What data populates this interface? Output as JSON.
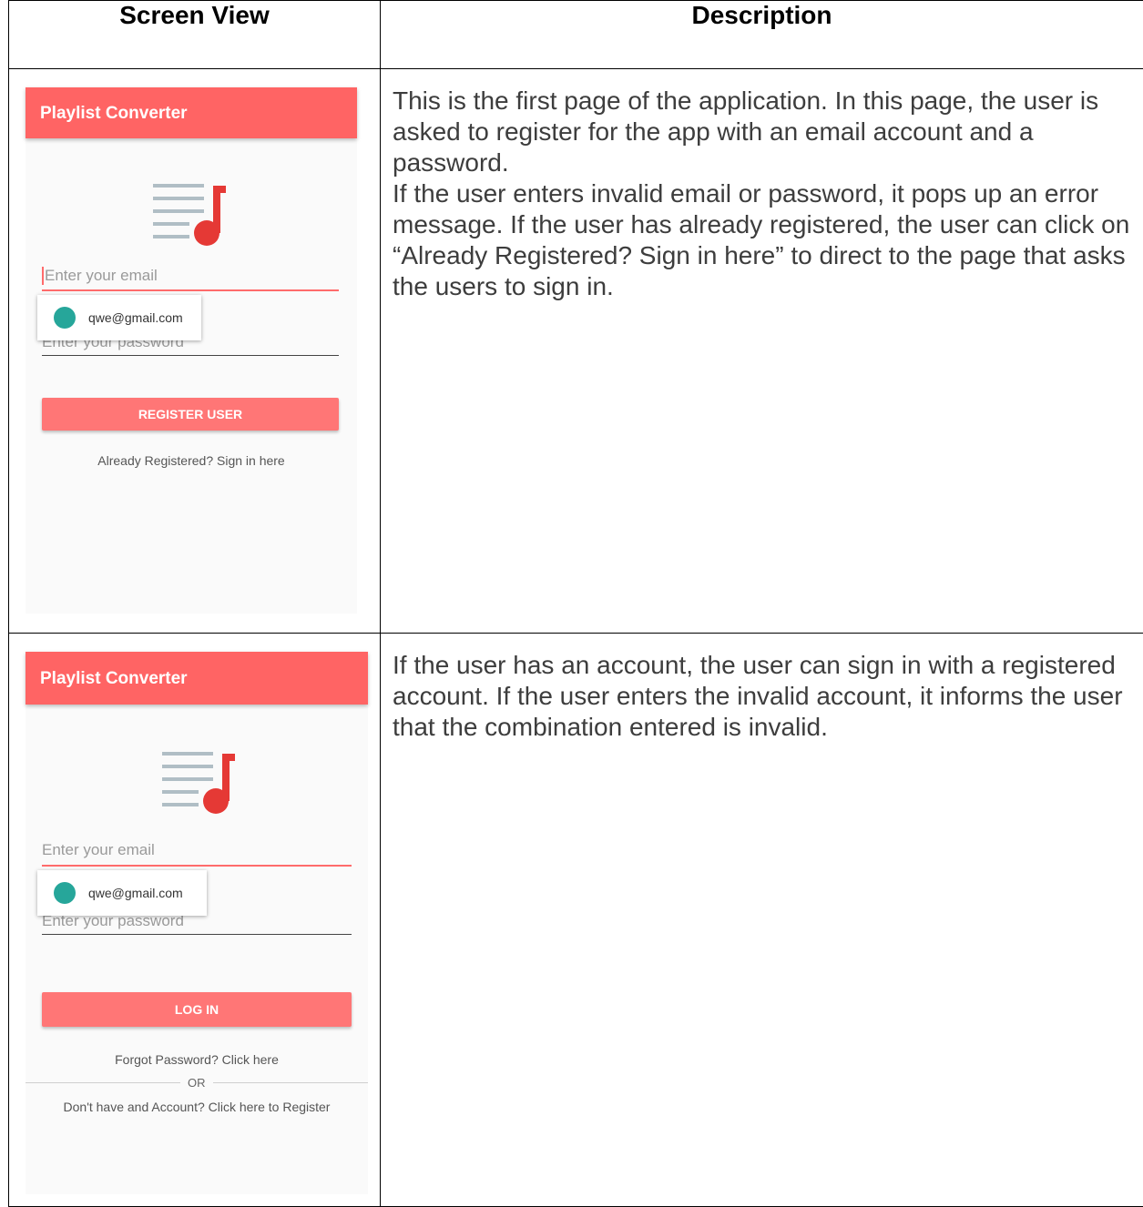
{
  "table": {
    "header_screen": "Screen View",
    "header_description": "Description"
  },
  "rows": [
    {
      "screen": {
        "app_title": "Playlist Converter",
        "email_placeholder": "Enter your email",
        "password_placeholder": "Enter your password",
        "suggestion": "qwe@gmail.com",
        "primary_button": "REGISTER USER",
        "link": "Already Registered? Sign in here"
      },
      "description": [
        "This is the first page of the application. In this page, the user is asked to register for the app with an email account and a password.",
        "If the user enters invalid email or password, it pops up an error message. If the user has already registered, the user can click on “Already Registered? Sign in here” to direct to the page that asks the users to sign in."
      ]
    },
    {
      "screen": {
        "app_title": "Playlist Converter",
        "email_placeholder": "Enter your email",
        "password_placeholder": "Enter your password",
        "suggestion": "qwe@gmail.com",
        "primary_button": "LOG IN",
        "forgot_link": "Forgot Password? Click here",
        "or_text": "OR",
        "register_link": "Don't have and Account? Click here to Register"
      },
      "description": [
        "If the user has an account, the user can sign in with a registered account. If the user enters the invalid account, it informs the user that the combination entered is invalid."
      ]
    }
  ],
  "colors": {
    "app_bar": "#ff6464",
    "button": "#ff7676",
    "accent_line": "#ff6b6b",
    "logo_lines": "#b0bec5",
    "logo_note": "#e53935",
    "avatar": "#26a69a"
  }
}
